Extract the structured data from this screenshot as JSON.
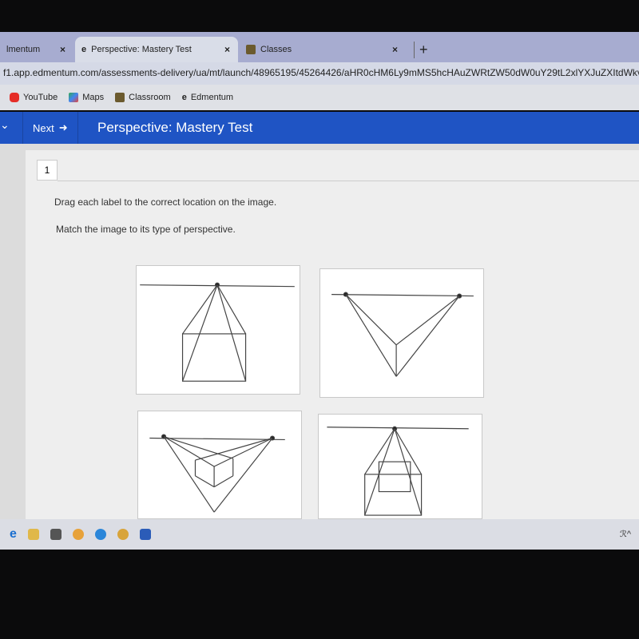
{
  "browser": {
    "tabs": [
      {
        "label": "lmentum",
        "icon": "edmentum-icon"
      },
      {
        "label": "Perspective: Mastery Test",
        "icon": "edmentum-icon",
        "active": true
      },
      {
        "label": "Classes",
        "icon": "classroom-icon"
      }
    ],
    "close_glyph": "×",
    "new_tab": "+",
    "url": "f1.app.edmentum.com/assessments-delivery/ua/mt/launch/48965195/45264426/aHR0cHM6Ly9mMS5hcHAuZWRtZW50dW0uY29tL2xlYXJuZXItdWkvd",
    "bookmarks": [
      {
        "label": "YouTube",
        "icon": "youtube-icon",
        "color": "#e52d27"
      },
      {
        "label": "Maps",
        "icon": "maps-icon",
        "color": "#34a853"
      },
      {
        "label": "Classroom",
        "icon": "classroom-icon",
        "color": "#6b5a2e"
      },
      {
        "label": "Edmentum",
        "icon": "edmentum-icon",
        "color": "#222222"
      }
    ]
  },
  "header": {
    "next_label": "Next",
    "title": "Perspective: Mastery Test",
    "color": "#1f54c4"
  },
  "question": {
    "number": "1",
    "instruction": "Drag each label to the correct location on the image.",
    "prompt": "Match the image to its type of perspective."
  },
  "images": [
    {
      "name": "one-point-perspective-box"
    },
    {
      "name": "two-point-perspective-v"
    },
    {
      "name": "two-point-perspective-box"
    },
    {
      "name": "one-point-perspective-frame"
    }
  ],
  "taskbar": {
    "tray": "ℛ^"
  }
}
